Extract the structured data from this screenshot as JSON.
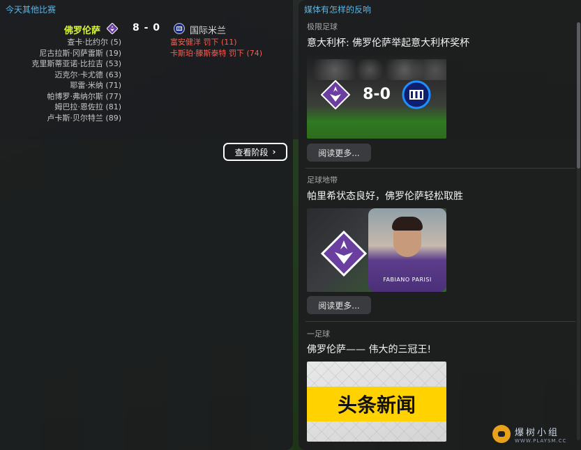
{
  "left": {
    "title": "今天其他比赛",
    "home_team": "佛罗伦萨",
    "away_team": "国际米兰",
    "score": "8 - 0",
    "home_scorers": [
      "查卡·比约尔 (5)",
      "尼古拉斯·冈萨雷斯 (19)",
      "克里斯蒂亚诺·比拉吉 (53)",
      "迈克尔·卡尤德 (63)",
      "耶雷·米纳 (71)",
      "帕博罗·弗纳尔斯 (77)",
      "姆巴拉·恩佐拉 (81)",
      "卢卡斯·贝尔特兰 (89)"
    ],
    "away_events": [
      "富安健洋 罚下 (11)",
      "卡斯珀·滕斯泰特 罚下 (74)"
    ],
    "stage_button": "查看阶段"
  },
  "right": {
    "title": "媒体有怎样的反响",
    "news": [
      {
        "source": "极限足球",
        "headline": "意大利杯: 佛罗伦萨举起意大利杯奖杯",
        "image_score": "8-0",
        "read_more": "阅读更多..."
      },
      {
        "source": "足球地带",
        "headline": "帕里希状态良好，佛罗伦萨轻松取胜",
        "image_caption": "FABIANO PARISI",
        "read_more": "阅读更多..."
      },
      {
        "source": "一足球",
        "headline": "佛罗伦萨—— 伟大的三冠王!",
        "image_banner": "头条新闻"
      }
    ]
  },
  "watermark": {
    "text": "爆树小组",
    "url": "WWW.PLAYSM.CC"
  },
  "colors": {
    "accent_blue": "#5bb7e6",
    "home_team_highlight": "#d6f23c",
    "red_card_text": "#ff5a4e",
    "fiorentina_purple": "#6b3fa0",
    "inter_blue": "#1b2d86"
  },
  "icons": {
    "home_crest": "fiorentina-crest-icon",
    "away_crest": "inter-crest-icon",
    "stage_chevron": "chevron-right-icon"
  }
}
